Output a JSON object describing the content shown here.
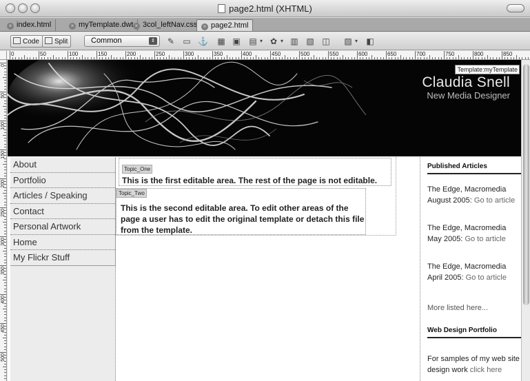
{
  "window": {
    "title": "page2.html (XHTML)"
  },
  "tabs": [
    {
      "label": "index.html"
    },
    {
      "label": "myTemplate.dwt"
    },
    {
      "label": "3col_leftNav.css*"
    },
    {
      "label": "page2.html"
    }
  ],
  "toolbar": {
    "code_label": "Code",
    "split_label": "Split",
    "category_select": "Common"
  },
  "ruler": {
    "marks": [
      "0",
      "50",
      "100",
      "150",
      "200",
      "250",
      "300",
      "350",
      "400",
      "450",
      "500",
      "550",
      "600",
      "650",
      "700",
      "750",
      "800",
      "850"
    ]
  },
  "banner": {
    "template_tag": "Template:myTemplate",
    "name": "Claudia Snell",
    "subtitle": "New Media Designer"
  },
  "nav": {
    "items": [
      "About",
      "Portfolio",
      "Articles / Speaking",
      "Contact",
      "Personal Artwork",
      "Home",
      "My Flickr Stuff"
    ]
  },
  "editable": {
    "one_tag": "Topic_One",
    "one_text": "This is the first editable area. The rest of the page is not editable.",
    "two_tag": "Topic_Two",
    "two_text": "This is the second editable area. To edit other areas of the page a user has to edit the original template or detach this file from the template."
  },
  "right": {
    "published_heading": "Published Articles",
    "articles": [
      {
        "line1": "The Edge, Macromedia",
        "date": "August 2005:",
        "link": "Go to article"
      },
      {
        "line1": "The Edge, Macromedia",
        "date": "May 2005:",
        "link": "Go to article"
      },
      {
        "line1": "The Edge, Macromedia",
        "date": "April 2005:",
        "link": "Go to article"
      }
    ],
    "more": "More listed here...",
    "portfolio_heading": "Web Design Portfolio",
    "portfolio_text": "For samples of my web site design work",
    "portfolio_link": "click here"
  }
}
